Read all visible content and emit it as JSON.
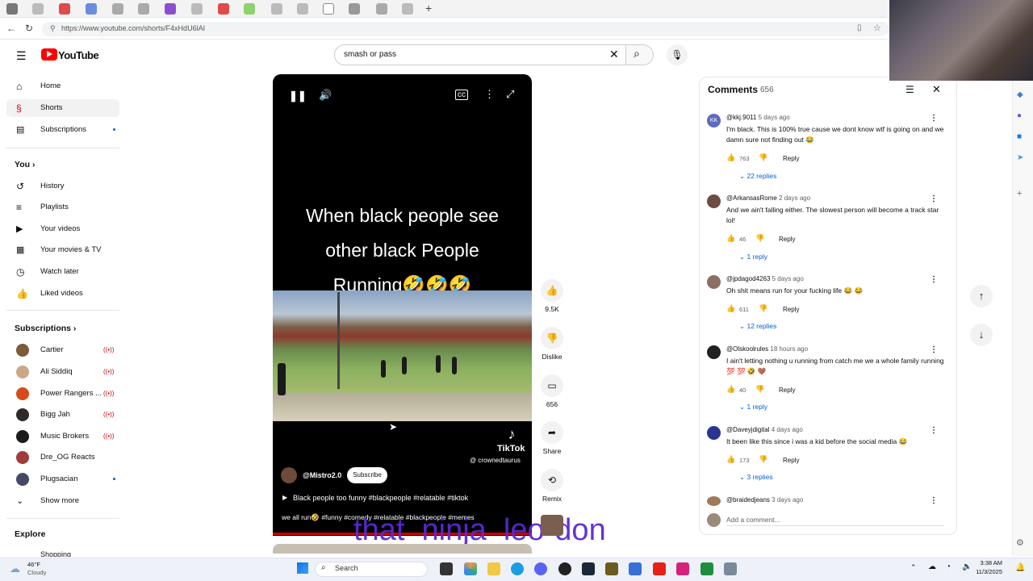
{
  "browser": {
    "url": "https://www.youtube.com/shorts/F4xHdU6lAI"
  },
  "header": {
    "logo_text": "YouTube",
    "search_query": "smash or pass"
  },
  "sidebar": {
    "main": [
      {
        "label": "Home",
        "icon": "home-icon"
      },
      {
        "label": "Shorts",
        "icon": "shorts-icon"
      },
      {
        "label": "Subscriptions",
        "icon": "subscriptions-icon"
      }
    ],
    "you_heading": "You",
    "you_items": [
      {
        "label": "History",
        "icon": "history-icon"
      },
      {
        "label": "Playlists",
        "icon": "playlists-icon"
      },
      {
        "label": "Your videos",
        "icon": "your-videos-icon"
      },
      {
        "label": "Your movies & TV",
        "icon": "movies-icon"
      },
      {
        "label": "Watch later",
        "icon": "clock-icon"
      },
      {
        "label": "Liked videos",
        "icon": "thumbs-up-icon"
      }
    ],
    "subs_heading": "Subscriptions",
    "subs": [
      {
        "label": "Cartier",
        "color": "#7a5b3a",
        "live": true
      },
      {
        "label": "Ali Siddiq",
        "color": "#c9a789",
        "live": true
      },
      {
        "label": "Power Rangers ...",
        "color": "#d64a1e",
        "live": true
      },
      {
        "label": "Bigg Jah",
        "color": "#2e2a2a",
        "live": true
      },
      {
        "label": "Music Brokers",
        "color": "#1b1b1b",
        "live": true
      },
      {
        "label": "Dre_OG Reacts",
        "color": "#a23b3b",
        "live": false
      },
      {
        "label": "Plugsacian",
        "color": "#444a66",
        "live": false
      }
    ],
    "show_more": "Show more",
    "explore_heading": "Explore",
    "explore_partial": "Shopping",
    "live_glyph": "((•))"
  },
  "video": {
    "overlay_lines": [
      "When black people see",
      "other black People",
      "Running🤣🤣🤣"
    ],
    "tiktok_label": "TikTok",
    "tiktok_handle": "@ crownedtaurus",
    "channel": "@Mistro2.0",
    "subscribe_label": "Subscribe",
    "description": "Black people too funny #blackpeople #relatable #tiktok",
    "sound_text": "we all run🤣 #funny #comedy #relatable #blackpeople #memes",
    "watermark": "that_ninja_leo-don"
  },
  "actions": {
    "likes": "9.5K",
    "dislike_label": "Dislike",
    "comments_count": "656",
    "share_label": "Share",
    "remix_label": "Remix"
  },
  "comments": {
    "title": "Comments",
    "count": "656",
    "add_placeholder": "Add a comment...",
    "reply_label": "Reply",
    "items": [
      {
        "handle": "@kkj.9011",
        "time": "5 days ago",
        "avatar_color": "#5c6bc0",
        "avatar_text": "KK",
        "text": "I'm black. This is 100% true cause we dont know wtf is going on and we damn sure not finding out 😂",
        "likes": "763",
        "replies": "22 replies"
      },
      {
        "handle": "@ArkansasRome",
        "time": "2 days ago",
        "avatar_color": "#6d4c41",
        "avatar_text": "",
        "text": "And we ain't falling either. The slowest person will become a track star lol!",
        "likes": "46",
        "replies": "1 reply"
      },
      {
        "handle": "@jpdagod4263",
        "time": "5 days ago",
        "avatar_color": "#8d6e63",
        "avatar_text": "",
        "text": "Oh shit means run for your fucking life 😂 😂",
        "likes": "611",
        "replies": "12 replies"
      },
      {
        "handle": "@Olskoolrules",
        "time": "18 hours ago",
        "avatar_color": "#212121",
        "avatar_text": "",
        "text": "I ain't letting nothing u running from catch me we a whole family running 💯 💯 🤣 🤎",
        "likes": "40",
        "replies": "1 reply"
      },
      {
        "handle": "@Daveyjdigital",
        "time": "4 days ago",
        "avatar_color": "#283593",
        "avatar_text": "",
        "text": "It been like this since i was a kid before the social media 😂",
        "likes": "173",
        "replies": "3 replies"
      },
      {
        "handle": "@braidedjeans",
        "time": "3 days ago",
        "avatar_color": "#9e7b5a",
        "avatar_text": "",
        "text": "",
        "likes": "",
        "replies": ""
      }
    ]
  },
  "taskbar": {
    "weather_temp": "46°F",
    "weather_desc": "Cloudy",
    "search_label": "Search",
    "time": "3:38 AM",
    "date": "11/3/2025"
  }
}
